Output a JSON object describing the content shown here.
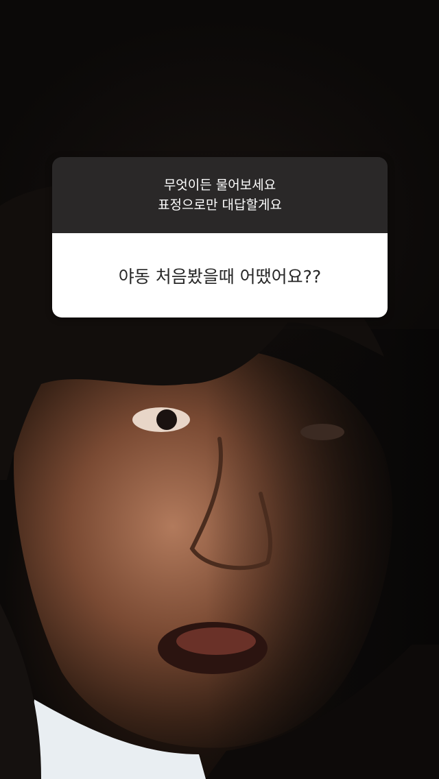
{
  "question_sticker": {
    "prompt_line_1": "무엇이든 물어보세요",
    "prompt_line_2": "표정으로만 대답할게요",
    "question": "야동 처음봤을때 어땠어요??"
  },
  "colors": {
    "card_header_bg": "#2a2828",
    "card_body_bg": "#ffffff",
    "question_text": "#262626",
    "prompt_text": "#ffffff"
  }
}
